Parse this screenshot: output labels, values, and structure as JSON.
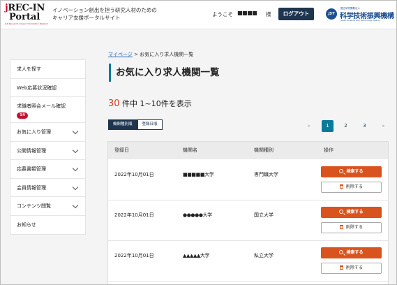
{
  "header": {
    "logo": {
      "line1": "jREC-IN",
      "line2": "Portal",
      "line3": "Job Research Career Information Network"
    },
    "tagline_1": "イノベーション創出を担う研究人材のための",
    "tagline_2": "キャリア支援ポータルサイト",
    "greeting": "ようこそ",
    "user_name": "■■■■",
    "honorific": "様",
    "logout_label": "ログアウト",
    "jst": {
      "mark": "JST",
      "small": "国立研究開発法人",
      "name": "科学技術振興機構",
      "sub": "Japan Science and Technology Agency"
    }
  },
  "sidebar": {
    "items": [
      {
        "label": "求人を探す"
      },
      {
        "label": "Web応募状況確認"
      },
      {
        "label": "求職者照会メール確認",
        "badge": "14"
      },
      {
        "label": "お気に入り管理"
      },
      {
        "label": "公開情報管理"
      },
      {
        "label": "応募書類管理"
      },
      {
        "label": "会員情報管理"
      },
      {
        "label": "コンテンツ閲覧"
      },
      {
        "label": "お知らせ"
      }
    ]
  },
  "breadcrumb": {
    "link": "マイページ",
    "separator": " > ",
    "current": "お気に入り求人機関一覧"
  },
  "page_title": "お気に入り求人機関一覧",
  "results": {
    "count": "30",
    "text": " 件中 1~10件を表示"
  },
  "sort": {
    "by_type": "機関種別順",
    "by_date": "登録日順"
  },
  "pagination": {
    "prev": "«",
    "pages": [
      "1",
      "2",
      "3"
    ],
    "current": "1",
    "next": "»"
  },
  "table": {
    "headers": [
      "登録日",
      "機関名",
      "機関種別",
      "操作"
    ],
    "rows": [
      {
        "date": "2022年10月01日",
        "name": "■■■■■大学",
        "type": "専門職大学"
      },
      {
        "date": "2022年10月01日",
        "name": "●●●●●大学",
        "type": "国立大学"
      },
      {
        "date": "2022年10月01日",
        "name": "▲▲▲▲▲大学",
        "type": "私立大学"
      }
    ],
    "search_label": "検索する",
    "delete_label": "削除する"
  },
  "colors": {
    "accent": "#0a7a99",
    "navy": "#1e3550",
    "orange": "#d9531e",
    "red": "#c8102e"
  }
}
